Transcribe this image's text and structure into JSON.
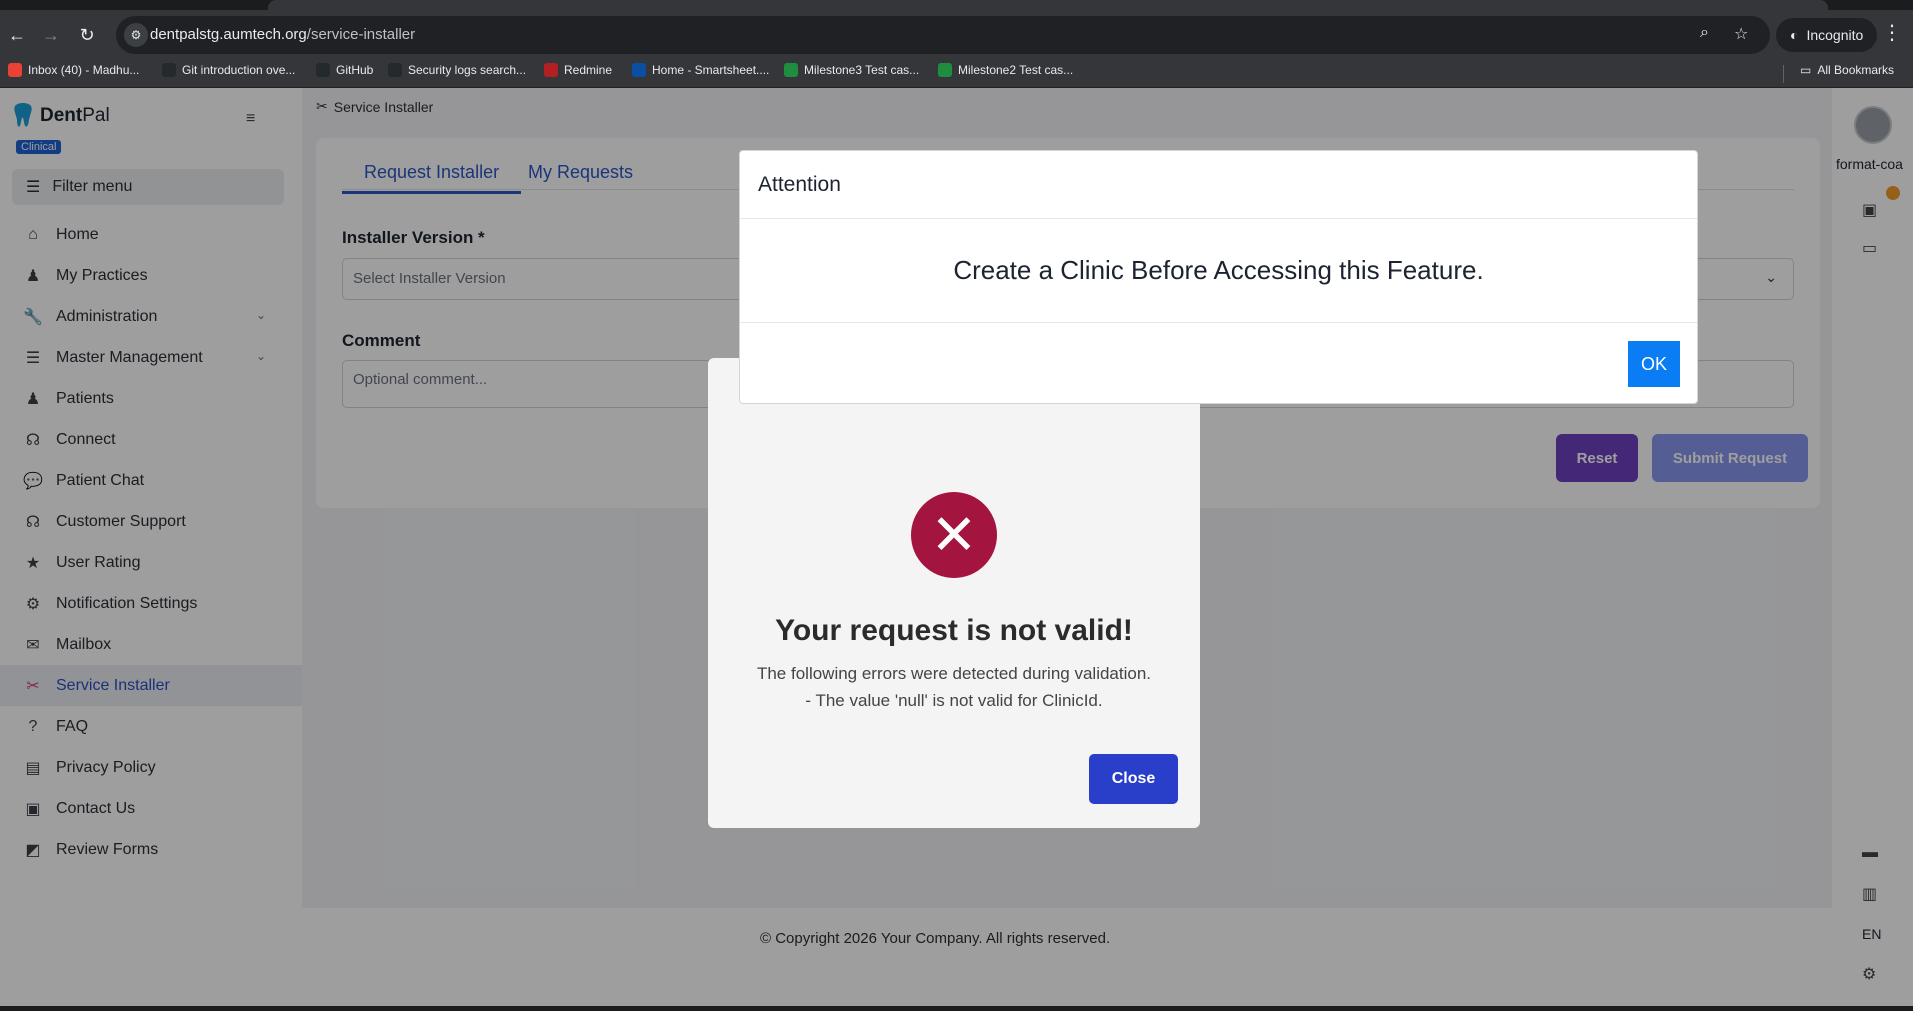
{
  "browser": {
    "url_host": "dentpalstg.aumtech.org",
    "url_path": "/service-installer",
    "incognito_label": "Incognito",
    "bookmarks": [
      {
        "label": "Inbox (40) - Madhu...",
        "icon": "gmail-icon",
        "color": "#ea4335"
      },
      {
        "label": "Git introduction ove...",
        "icon": "github-icon",
        "color": "#24292e"
      },
      {
        "label": "GitHub",
        "icon": "github-icon",
        "color": "#24292e"
      },
      {
        "label": "Security logs search...",
        "icon": "github-icon",
        "color": "#24292e"
      },
      {
        "label": "Redmine",
        "icon": "redmine-icon",
        "color": "#b32024"
      },
      {
        "label": "Home - Smartsheet....",
        "icon": "smartsheet-icon",
        "color": "#0b4fa3"
      },
      {
        "label": "Milestone3 Test cas...",
        "icon": "sheets-icon",
        "color": "#1e8e3e"
      },
      {
        "label": "Milestone2 Test cas...",
        "icon": "sheets-icon",
        "color": "#1e8e3e"
      }
    ],
    "all_bookmarks_label": "All Bookmarks"
  },
  "sidebar": {
    "brand_bold": "Dent",
    "brand_rest": "Pal",
    "badge": "Clinical",
    "filter_label": "Filter menu",
    "items": [
      {
        "label": "Home",
        "icon": "home-icon",
        "glyph": "⌂"
      },
      {
        "label": "My Practices",
        "icon": "user-tie-icon",
        "glyph": "♟"
      },
      {
        "label": "Administration",
        "icon": "wrench-icon",
        "glyph": "🔧",
        "expandable": true
      },
      {
        "label": "Master Management",
        "icon": "list-icon",
        "glyph": "☰",
        "expandable": true
      },
      {
        "label": "Patients",
        "icon": "patient-icon",
        "glyph": "♟"
      },
      {
        "label": "Connect",
        "icon": "headset-icon",
        "glyph": "☊"
      },
      {
        "label": "Patient Chat",
        "icon": "chat-icon",
        "glyph": "💬"
      },
      {
        "label": "Customer Support",
        "icon": "headset-icon",
        "glyph": "☊"
      },
      {
        "label": "User Rating",
        "icon": "star-icon",
        "glyph": "★"
      },
      {
        "label": "Notification Settings",
        "icon": "cogs-icon",
        "glyph": "⚙"
      },
      {
        "label": "Mailbox",
        "icon": "envelope-icon",
        "glyph": "✉"
      },
      {
        "label": "Service Installer",
        "icon": "tools-icon",
        "glyph": "✂",
        "active": true
      },
      {
        "label": "FAQ",
        "icon": "question-icon",
        "glyph": "?"
      },
      {
        "label": "Privacy Policy",
        "icon": "file-icon",
        "glyph": "▤"
      },
      {
        "label": "Contact Us",
        "icon": "contact-icon",
        "glyph": "▣"
      },
      {
        "label": "Review Forms",
        "icon": "chart-icon",
        "glyph": "◩"
      }
    ]
  },
  "main": {
    "breadcrumb": "Service Installer",
    "tabs": [
      "Request Installer",
      "My Requests"
    ],
    "installer_label": "Installer Version *",
    "installer_placeholder": "Select Installer Version",
    "comment_label": "Comment",
    "comment_placeholder": "Optional comment...",
    "reset_label": "Reset",
    "submit_label": "Submit Request"
  },
  "footer": {
    "copyright": "© Copyright 2026 Your Company. All rights reserved."
  },
  "rail": {
    "username": "format-coa",
    "lang": "EN"
  },
  "error_dialog": {
    "title": "Your request is not valid!",
    "line1": "The following errors were detected during validation.",
    "line2": "- The value 'null' is not valid for ClinicId.",
    "close_label": "Close"
  },
  "attention_modal": {
    "title": "Attention",
    "message": "Create a Clinic Before Accessing this Feature.",
    "ok_label": "OK"
  },
  "colors": {
    "accent": "#2a56c6",
    "reset": "#6f42c1",
    "submit": "#8a96f0",
    "error": "#a3143f",
    "ok": "#0a7cf4"
  }
}
